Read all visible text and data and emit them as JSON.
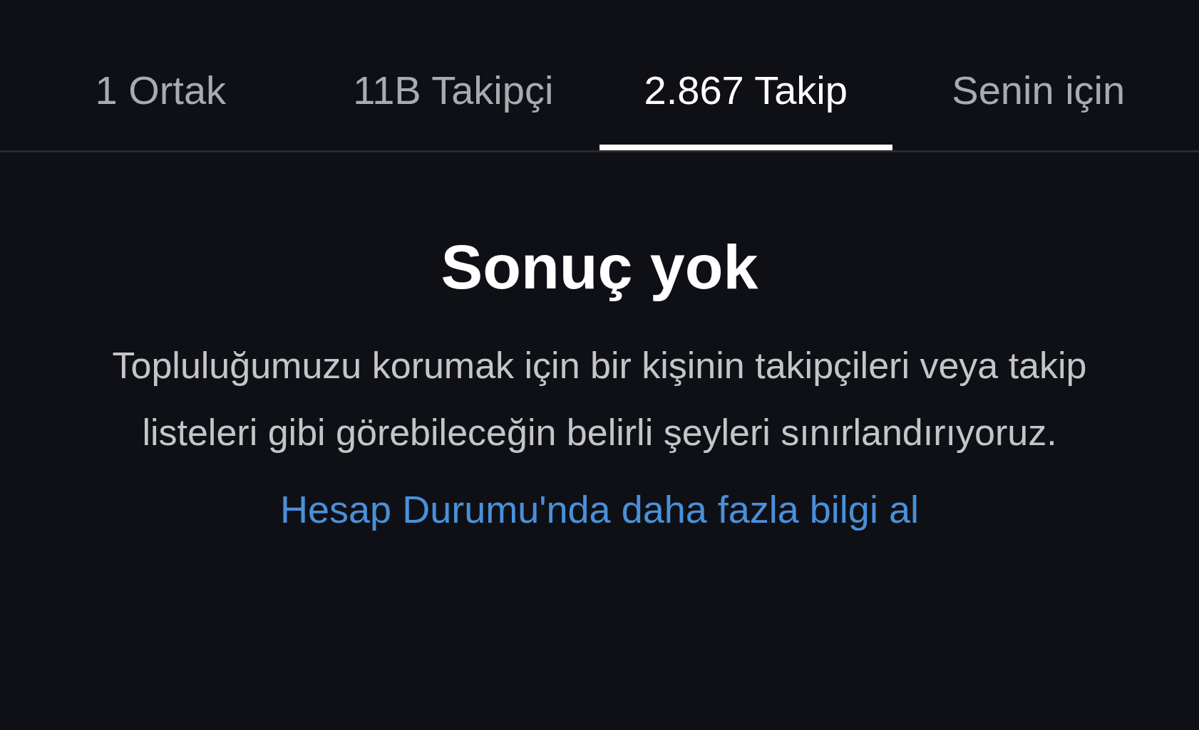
{
  "tabs": [
    {
      "label": "1 Ortak",
      "selected": false
    },
    {
      "label": "11B Takipçi",
      "selected": false
    },
    {
      "label": "2.867 Takip",
      "selected": true
    },
    {
      "label": "Senin için",
      "selected": false
    }
  ],
  "empty_state": {
    "title": "Sonuç yok",
    "message": "Topluluğumuzu korumak için bir kişinin takipçileri veya takip listeleri gibi görebileceğin belirli şeyleri sınırlandırıyoruz.",
    "link": "Hesap Durumu'nda daha fazla bilgi al"
  }
}
